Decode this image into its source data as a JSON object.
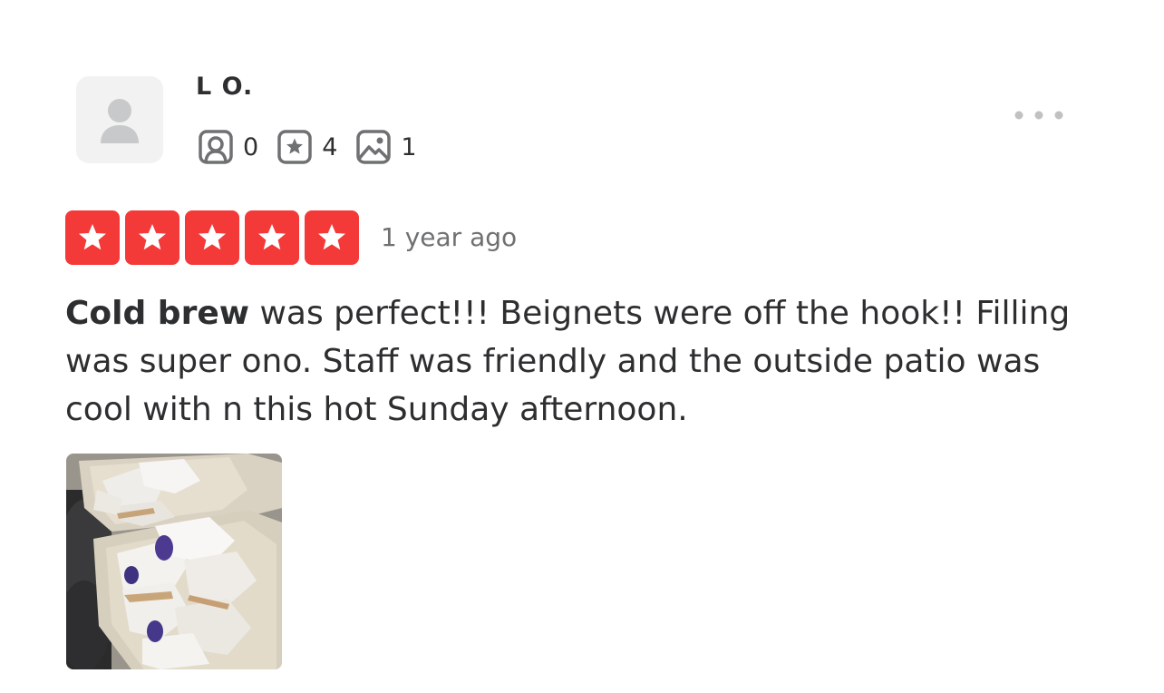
{
  "user": {
    "name": "L O.",
    "friends_count": "0",
    "reviews_count": "4",
    "photos_count": "1",
    "avatar_icon": "user-silhouette-icon"
  },
  "icons": {
    "friends": "friends-icon",
    "reviews": "review-star-icon",
    "photos": "photo-icon",
    "more": "more-dots-icon",
    "rating_star": "star-icon"
  },
  "review": {
    "rating": 5,
    "rating_max": 5,
    "timestamp": "1 year ago",
    "highlight": "Cold brew",
    "text": " was perfect!!! Beignets were off the hook!! Filling was super ono. Staff was friendly and the outside patio was cool with n this hot Sunday afternoon."
  },
  "colors": {
    "star_red": "#f43939",
    "text_dark": "#2d2e2f",
    "text_muted": "#6e7072",
    "icon_gray": "#6e7072",
    "avatar_bg": "#f2f2f2",
    "avatar_fg": "#c8c9ca"
  }
}
